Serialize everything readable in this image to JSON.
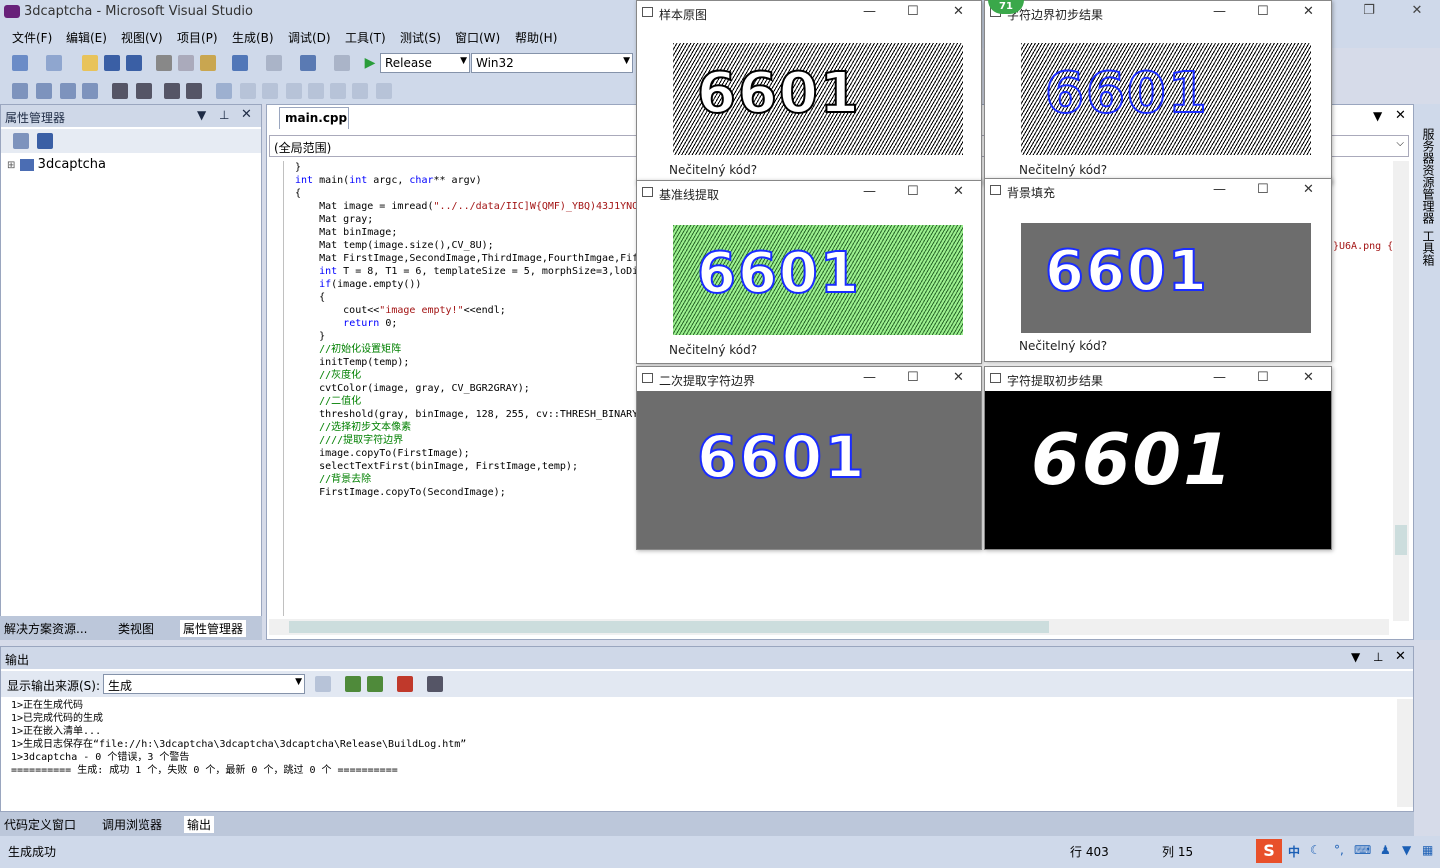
{
  "window": {
    "title": "3dcaptcha - Microsoft Visual Studio"
  },
  "menu": [
    "文件(F)",
    "编辑(E)",
    "视图(V)",
    "项目(P)",
    "生成(B)",
    "调试(D)",
    "工具(T)",
    "测试(S)",
    "窗口(W)",
    "帮助(H)"
  ],
  "toolbar": {
    "config": "Release",
    "platform": "Win32"
  },
  "left_panel": {
    "title": "属性管理器",
    "tree_item": "3dcaptcha",
    "tabs": [
      "解决方案资源...",
      "类视图",
      "属性管理器"
    ]
  },
  "editor": {
    "tab": "main.cpp",
    "scope": "(全局范围)",
    "lines": [
      "}",
      "",
      "",
      "int main(int argc, char** argv)",
      "{",
      "    Mat image = imread(\"../../data/IIC]W{QMF)_YBQ)43J1YNOL",
      "    Mat gray;",
      "    Mat binImage;",
      "    Mat temp(image.size(),CV_8U);",
      "    Mat FirstImage,SecondImage,ThirdImage,FourthImgae,Fif",
      "",
      "    int T = 8, T1 = 6, templateSize = 5, morphSize=3,loDi",
      "",
      "    if(image.empty())",
      "    {",
      "        cout<<\"image empty!\"<<endl;",
      "        return 0;",
      "    }",
      "",
      "    //初始化设置矩阵",
      "    initTemp(temp);",
      "",
      "    //灰度化",
      "    cvtColor(image, gray, CV_BGR2GRAY);",
      "    //二值化",
      "    threshold(gray, binImage, 128, 255, cv::THRESH_BINARY",
      "",
      "    //选择初步文本像素",
      "    ////提取字符边界",
      "    image.copyTo(FirstImage);",
      "    selectTextFirst(binImage, FirstImage,temp);",
      "",
      "    //背景去除",
      "    FirstImage.copyTo(SecondImage);"
    ],
    "line_tail": "}U6A.png {"
  },
  "right_dock": [
    "服务器资源管理器",
    "工具箱"
  ],
  "output": {
    "title": "输出",
    "source_label": "显示输出来源(S):",
    "source_value": "生成",
    "lines": [
      "1>正在生成代码",
      "1>已完成代码的生成",
      "1>正在嵌入清单...",
      "1>生成日志保存在“file://h:\\3dcaptcha\\3dcaptcha\\3dcaptcha\\Release\\BuildLog.htm”",
      "1>3dcaptcha - 0 个错误，3 个警告",
      "========== 生成: 成功 1 个，失败 0 个，最新 0 个，跳过 0 个 =========="
    ],
    "tabs": [
      "代码定义窗口",
      "调用浏览器",
      "输出"
    ]
  },
  "status": {
    "left": "生成成功",
    "line": "行 403",
    "col": "列 15",
    "ime": "中"
  },
  "badge": "71",
  "floating": [
    {
      "title": "样本原图",
      "caption": "Nečitelný kód?"
    },
    {
      "title": "字符边界初步结果",
      "caption": "Nečitelný kód?"
    },
    {
      "title": "基准线提取",
      "caption": "Nečitelný kód?"
    },
    {
      "title": "背景填充",
      "caption": "Nečitelný kód?"
    },
    {
      "title": "二次提取字符边界"
    },
    {
      "title": "字符提取初步结果"
    }
  ],
  "captcha_text": "6601"
}
